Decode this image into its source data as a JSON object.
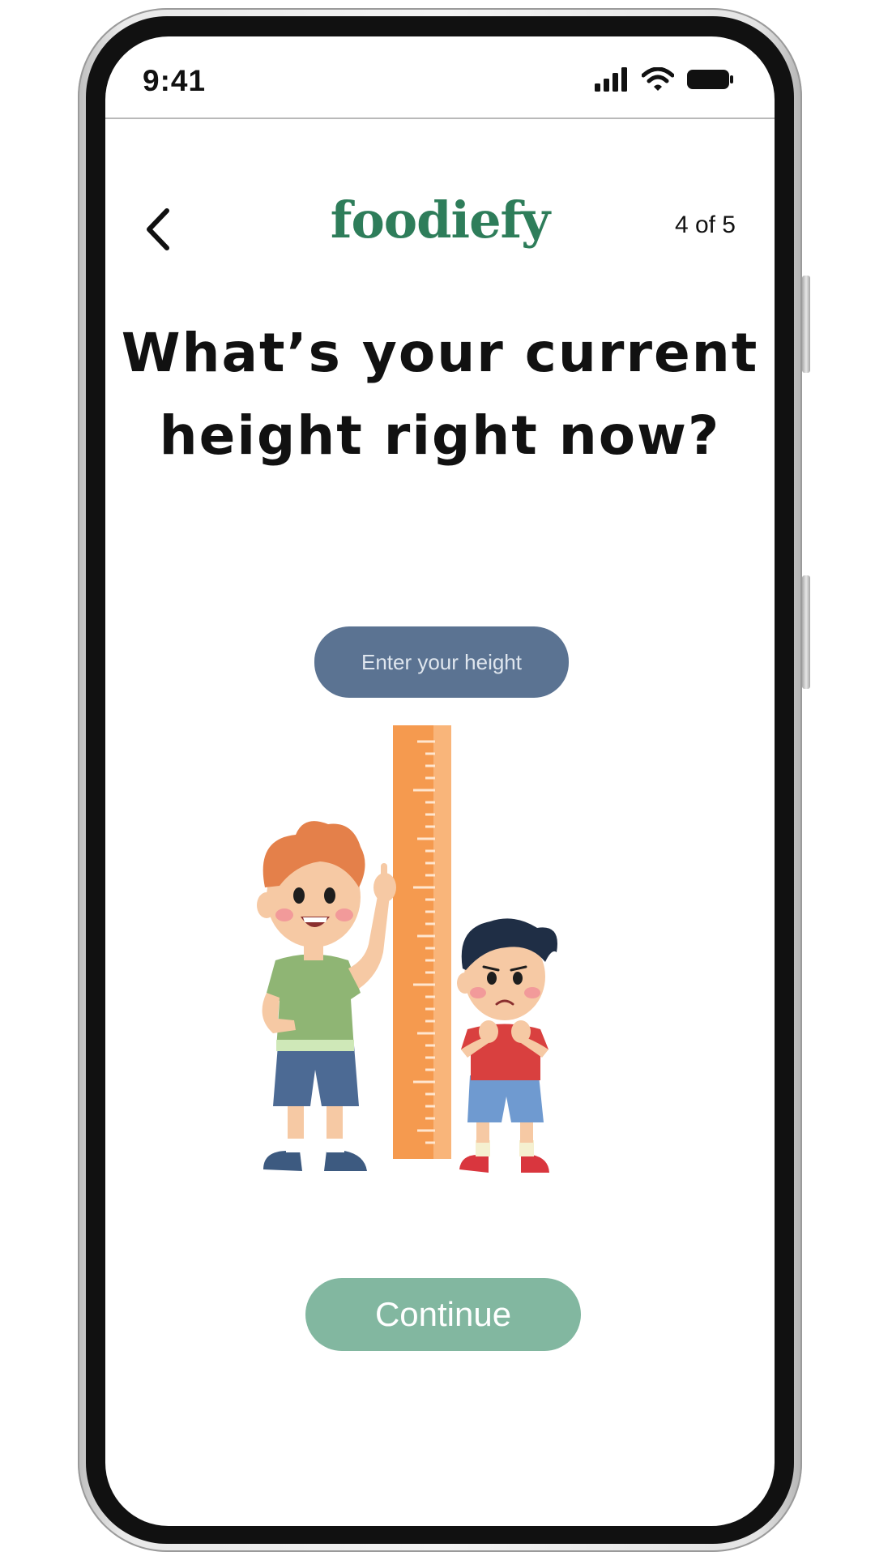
{
  "status_bar": {
    "time": "9:41"
  },
  "header": {
    "back_icon": "chevron-left-icon",
    "logo": "foodiefy",
    "step": "4 of 5"
  },
  "question": {
    "line1": "What’s your current",
    "line2": "height right now?"
  },
  "height_input": {
    "placeholder": "Enter your height",
    "value": ""
  },
  "illustration": {
    "subject": "two-kids-measuring-height-ruler"
  },
  "continue_button": {
    "label": "Continue"
  },
  "colors": {
    "brand": "#2e7d5a",
    "input_bg": "#5b7392",
    "continue_bg": "#82b7a0",
    "ruler": "#f59a4f"
  }
}
